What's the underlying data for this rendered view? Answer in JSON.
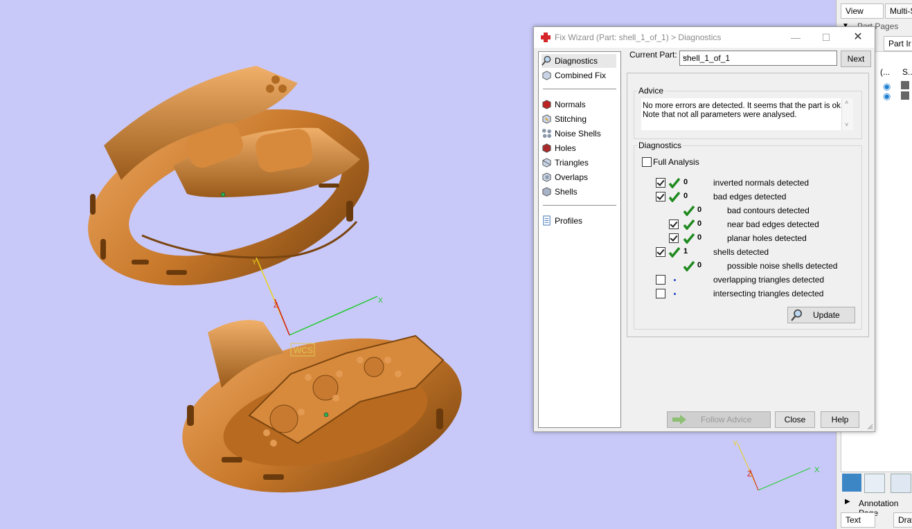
{
  "dialog": {
    "title": "Fix Wizard (Part: shell_1_of_1) > Diagnostics",
    "nav": {
      "top": [
        {
          "label": "Diagnostics",
          "icon": "magnifier-icon",
          "selected": true
        },
        {
          "label": "Combined Fix",
          "icon": "cube-icon",
          "selected": false
        }
      ],
      "fixes": [
        {
          "label": "Normals",
          "icon": "normals-cube-icon"
        },
        {
          "label": "Stitching",
          "icon": "stitching-cube-icon"
        },
        {
          "label": "Noise Shells",
          "icon": "noise-shells-icon"
        },
        {
          "label": "Holes",
          "icon": "holes-cube-icon"
        },
        {
          "label": "Triangles",
          "icon": "triangles-cube-icon"
        },
        {
          "label": "Overlaps",
          "icon": "overlaps-cube-icon"
        },
        {
          "label": "Shells",
          "icon": "shells-cube-icon"
        }
      ],
      "bottom": [
        {
          "label": "Profiles",
          "icon": "document-icon"
        }
      ]
    },
    "current_part_label": "Current Part:",
    "current_part_value": "shell_1_of_1",
    "next_label": "Next",
    "advice": {
      "title": "Advice",
      "text_line1": "No more errors are detected. It seems that the part is ok.",
      "text_line2": "Note that not all parameters were analysed."
    },
    "diagnostics": {
      "title": "Diagnostics",
      "full_analysis_label": "Full Analysis",
      "full_analysis_checked": false,
      "rows": [
        {
          "label": "inverted normals detected",
          "count": "0",
          "checked": true,
          "has_checkbox": true,
          "ok": true,
          "indent": 0
        },
        {
          "label": "bad edges detected",
          "count": "0",
          "checked": true,
          "has_checkbox": true,
          "ok": true,
          "indent": 0
        },
        {
          "label": "bad contours detected",
          "count": "0",
          "checked": false,
          "has_checkbox": false,
          "ok": true,
          "indent": 1
        },
        {
          "label": "near bad edges detected",
          "count": "0",
          "checked": true,
          "has_checkbox": true,
          "ok": true,
          "indent": 1
        },
        {
          "label": "planar holes detected",
          "count": "0",
          "checked": true,
          "has_checkbox": true,
          "ok": true,
          "indent": 1
        },
        {
          "label": "shells detected",
          "count": "1",
          "checked": true,
          "has_checkbox": true,
          "ok": true,
          "indent": 0
        },
        {
          "label": "possible noise shells detected",
          "count": "0",
          "checked": false,
          "has_checkbox": false,
          "ok": true,
          "indent": 1
        },
        {
          "label": "overlapping triangles detected",
          "count": "",
          "checked": false,
          "has_checkbox": true,
          "ok": false,
          "indent": 0
        },
        {
          "label": "intersecting triangles detected",
          "count": "",
          "checked": false,
          "has_checkbox": true,
          "ok": false,
          "indent": 0
        }
      ],
      "update_label": "Update"
    },
    "follow_advice_label": "Follow Advice",
    "close_label": "Close",
    "help_label": "Help"
  },
  "viewport": {
    "wcs_label": "WCS",
    "axis_x": "X",
    "axis_y": "Y",
    "axis_z": "Z"
  },
  "right_panel": {
    "tab_view": "View",
    "tab_multi": "Multi-S",
    "part_pages": "Part Pages",
    "part_info_tab": "Part Ir",
    "col1": "(...",
    "col2": "S...",
    "annotation_pages": "Annotation Page",
    "tab_text": "Text",
    "tab_drawing": "Drawing"
  },
  "colors": {
    "viewport_bg": "#c9c9f9",
    "model": "#c8782a",
    "check_green": "#1f8a1f",
    "title_icon_red": "#d4262b"
  }
}
